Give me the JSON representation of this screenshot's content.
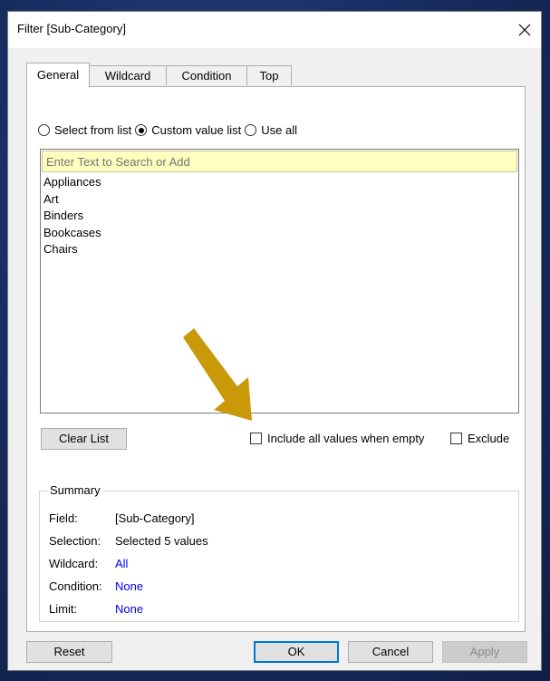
{
  "dialog": {
    "title": "Filter [Sub-Category]"
  },
  "tabs": [
    {
      "label": "General",
      "active": true
    },
    {
      "label": "Wildcard",
      "active": false
    },
    {
      "label": "Condition",
      "active": false
    },
    {
      "label": "Top",
      "active": false
    }
  ],
  "mode": {
    "options": [
      {
        "label": "Select from list",
        "checked": false
      },
      {
        "label": "Custom value list",
        "checked": true
      },
      {
        "label": "Use all",
        "checked": false
      }
    ]
  },
  "search": {
    "placeholder": "Enter Text to Search or Add"
  },
  "list": {
    "items": [
      "Appliances",
      "Art",
      "Binders",
      "Bookcases",
      "Chairs"
    ]
  },
  "controls": {
    "clear_list": "Clear List",
    "include_all_label": "Include all values when empty",
    "exclude_label": "Exclude"
  },
  "summary": {
    "legend": "Summary",
    "rows": [
      {
        "label": "Field:",
        "value": "[Sub-Category]"
      },
      {
        "label": "Selection:",
        "value": "Selected 5 values"
      },
      {
        "label": "Wildcard:",
        "value": "All"
      },
      {
        "label": "Condition:",
        "value": "None"
      },
      {
        "label": "Limit:",
        "value": "None"
      }
    ]
  },
  "footer": {
    "reset": "Reset",
    "ok": "OK",
    "cancel": "Cancel",
    "apply": "Apply"
  },
  "colors": {
    "arrow": "#c9990a",
    "link": "#0000ee",
    "search_bg": "#ffffbf"
  },
  "annotations": {
    "arrow_icon": "down-left-arrow-icon"
  }
}
